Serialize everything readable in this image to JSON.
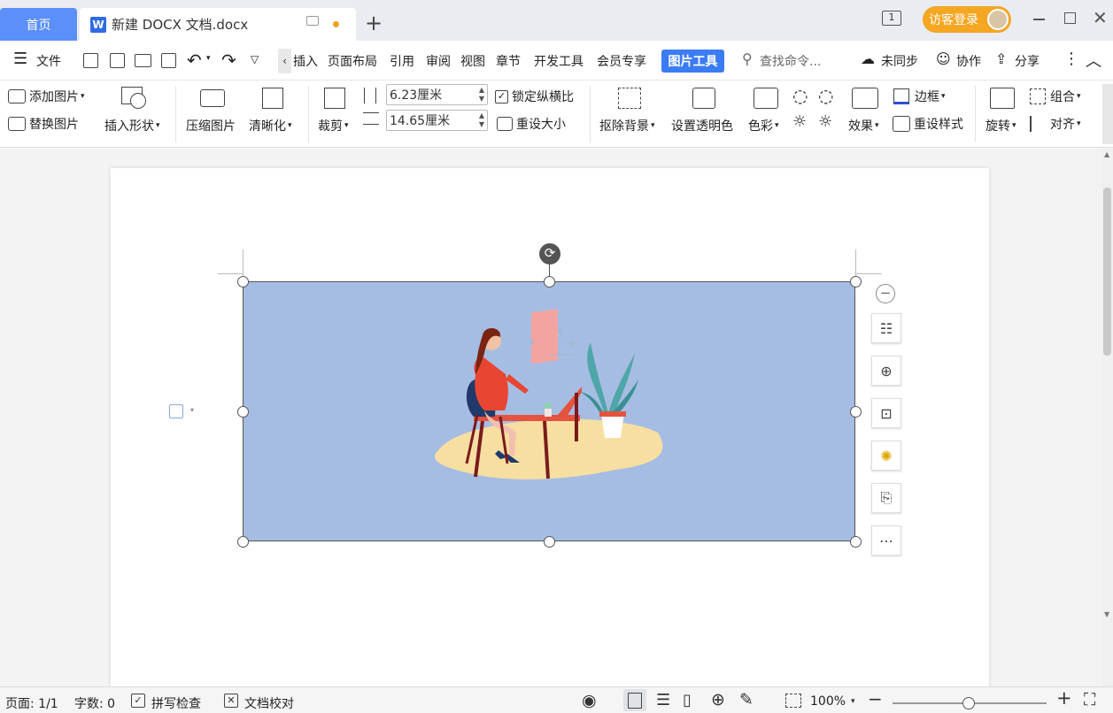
{
  "tabs": {
    "home": "首页",
    "doc_title": "新建 DOCX 文档.docx",
    "login": "访客登录",
    "page_num_icon": "1"
  },
  "menu": {
    "file": "文件",
    "items": [
      "插入",
      "页面布局",
      "引用",
      "审阅",
      "视图",
      "章节",
      "开发工具",
      "会员专享"
    ],
    "picture_tools": "图片工具",
    "search_placeholder": "查找命令...",
    "sync": "未同步",
    "collab": "协作",
    "share": "分享"
  },
  "ribbon": {
    "add_picture": "添加图片",
    "replace_picture": "替换图片",
    "insert_shape": "插入形状",
    "compress": "压缩图片",
    "sharpen": "清晰化",
    "crop": "裁剪",
    "width_value": "6.23厘米",
    "height_value": "14.65厘米",
    "lock_ratio": "锁定纵横比",
    "reset_size": "重设大小",
    "remove_bg": "抠除背景",
    "set_transparent": "设置透明色",
    "color": "色彩",
    "effects": "效果",
    "border": "边框",
    "reset_style": "重设样式",
    "rotate": "旋转",
    "group": "组合",
    "align": "对齐"
  },
  "status": {
    "page": "页面: 1/1",
    "words": "字数: 0",
    "spell_check": "拼写检查",
    "proofread": "文档校对",
    "zoom": "100%"
  },
  "colors": {
    "accent": "#3b7cf4",
    "home_tab": "#5b8ff9",
    "login": "#f5a623",
    "image_bg": "#a6bde3"
  },
  "zoom_level": 1.0
}
